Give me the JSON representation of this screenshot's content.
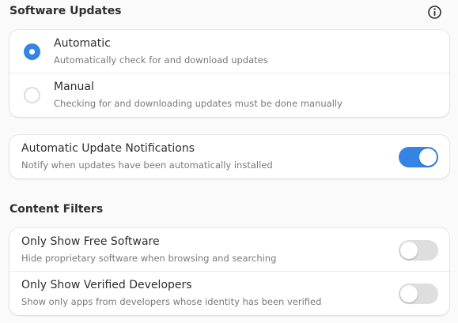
{
  "software_updates": {
    "title": "Software Updates",
    "info_icon": "info-icon",
    "options": [
      {
        "label": "Automatic",
        "description": "Automatically check for and download updates",
        "selected": true
      },
      {
        "label": "Manual",
        "description": "Checking for and downloading updates must be done manually",
        "selected": false
      }
    ]
  },
  "notifications": {
    "label": "Automatic Update Notifications",
    "description": "Notify when updates have been automatically installed",
    "enabled": true
  },
  "content_filters": {
    "title": "Content Filters",
    "items": [
      {
        "label": "Only Show Free Software",
        "description": "Hide proprietary software when browsing and searching",
        "enabled": false
      },
      {
        "label": "Only Show Verified Developers",
        "description": "Show only apps from developers whose identity has been verified",
        "enabled": false
      }
    ]
  },
  "colors": {
    "accent": "#3584e4",
    "switch_off": "#dedede",
    "background": "#fafafa"
  }
}
